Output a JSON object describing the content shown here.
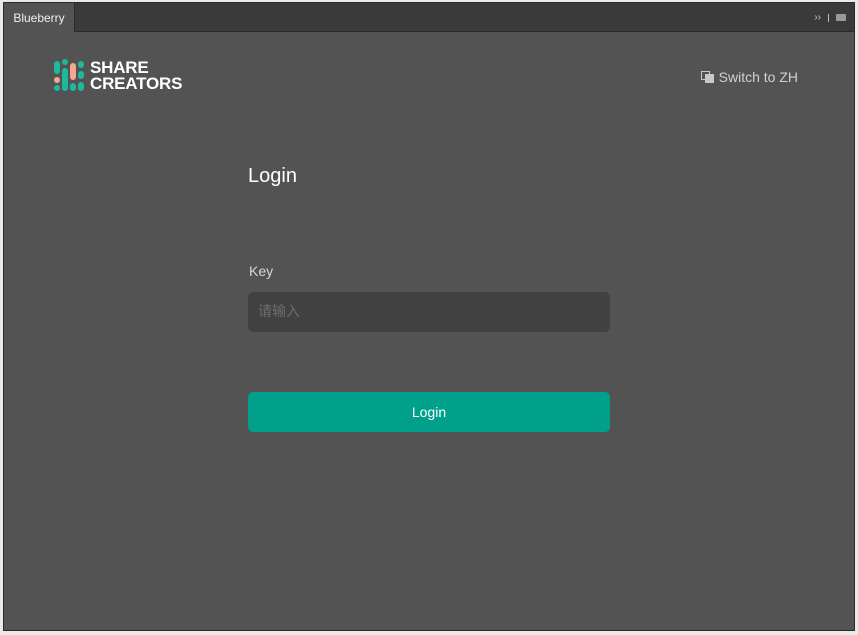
{
  "window": {
    "tab_title": "Blueberry",
    "more_glyph": "››",
    "panel_menu_icon": "panel-menu-icon"
  },
  "header": {
    "logo_line1": "SHARE",
    "logo_line2": "CREATORS",
    "logo_colors": {
      "teal": "#1fb89c",
      "peach": "#f0a992"
    },
    "lang_switch": {
      "label": "Switch to ZH",
      "icon": "translate-icon"
    }
  },
  "login": {
    "title": "Login",
    "key_label": "Key",
    "key_value": "",
    "key_placeholder": "请输入",
    "submit_label": "Login",
    "accent_color": "#00a08a"
  }
}
